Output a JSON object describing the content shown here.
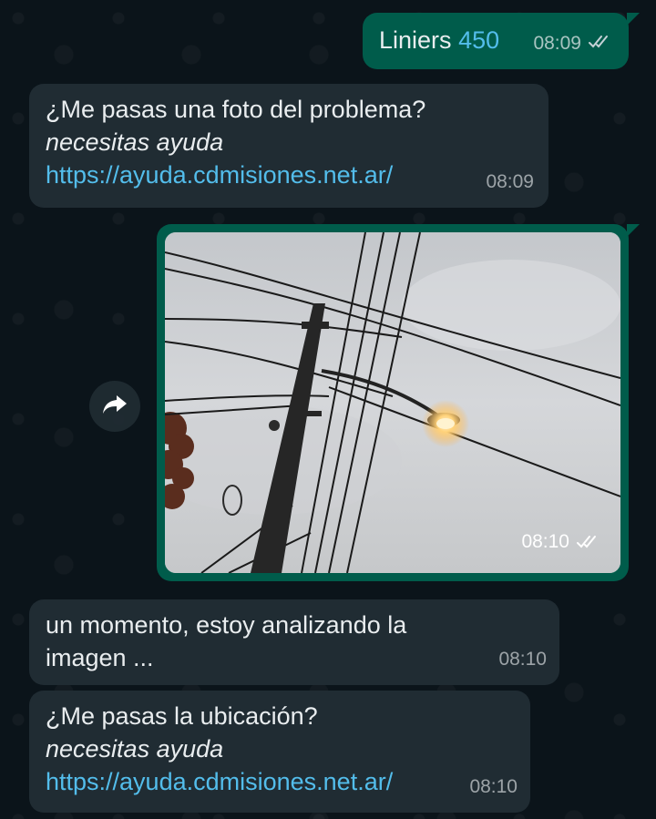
{
  "messages": [
    {
      "id": "m1",
      "direction": "outgoing",
      "text": "Liniers",
      "number": "450",
      "time": "08:09",
      "status": "read-double-check"
    },
    {
      "id": "m2",
      "direction": "incoming",
      "text": "¿Me pasas una foto del problema?",
      "italic": "necesitas ayuda",
      "link": "https://ayuda.cdmisiones.net.ar/",
      "time": "08:09"
    },
    {
      "id": "m3",
      "direction": "outgoing",
      "type": "image",
      "image_subject": "utility pole with lit street lamp",
      "time": "08:10",
      "status": "read-double-check"
    },
    {
      "id": "m4",
      "direction": "incoming",
      "line1": "un momento, estoy analizando la",
      "line2": "imagen ...",
      "time": "08:10"
    },
    {
      "id": "m5",
      "direction": "incoming",
      "text": "¿Me pasas la ubicación?",
      "italic": "necesitas ayuda",
      "link": "https://ayuda.cdmisiones.net.ar/",
      "time": "08:10"
    }
  ],
  "icons": {
    "forward": "forward-arrow-icon",
    "ticks": "double-check-icon"
  },
  "colors": {
    "background": "#0b141a",
    "incoming_bubble": "#202c33",
    "outgoing_bubble": "#005c4b",
    "link": "#53bdeb",
    "text": "#e9edef"
  }
}
